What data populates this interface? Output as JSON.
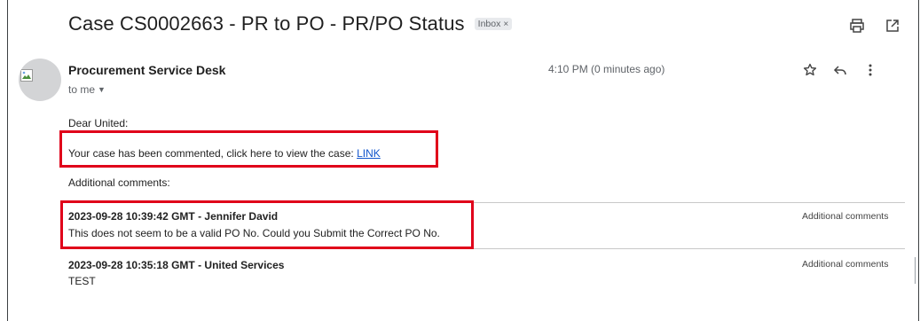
{
  "email": {
    "subject": "Case CS0002663 - PR to PO - PR/PO Status",
    "label": "Inbox",
    "label_remove": "×",
    "sender": "Procurement Service Desk",
    "recipient": "to me",
    "time": "4:10 PM (0 minutes ago)",
    "greeting": "Dear United:",
    "case_text": "Your case has been commented, click here to view the case: ",
    "case_link": "LINK",
    "additional_heading": "Additional comments:",
    "comments": [
      {
        "header": "2023-09-28 10:39:42 GMT - Jennifer David",
        "text": "This does not seem to be a valid PO No. Could you Submit the Correct PO No.",
        "type": "Additional comments"
      },
      {
        "header": "2023-09-28 10:35:18 GMT - United Services",
        "text": "TEST",
        "type": "Additional comments"
      }
    ]
  },
  "icons": {
    "print": "print-icon",
    "open_new": "open-in-new-window-icon",
    "star": "star-icon",
    "reply": "reply-icon",
    "more": "more-vertical-icon",
    "broken_image": "broken-image-icon",
    "caret": "caret-down-icon"
  },
  "colors": {
    "highlight": "#e0001a",
    "link": "#1155cc",
    "secondary_text": "#5f6368"
  }
}
